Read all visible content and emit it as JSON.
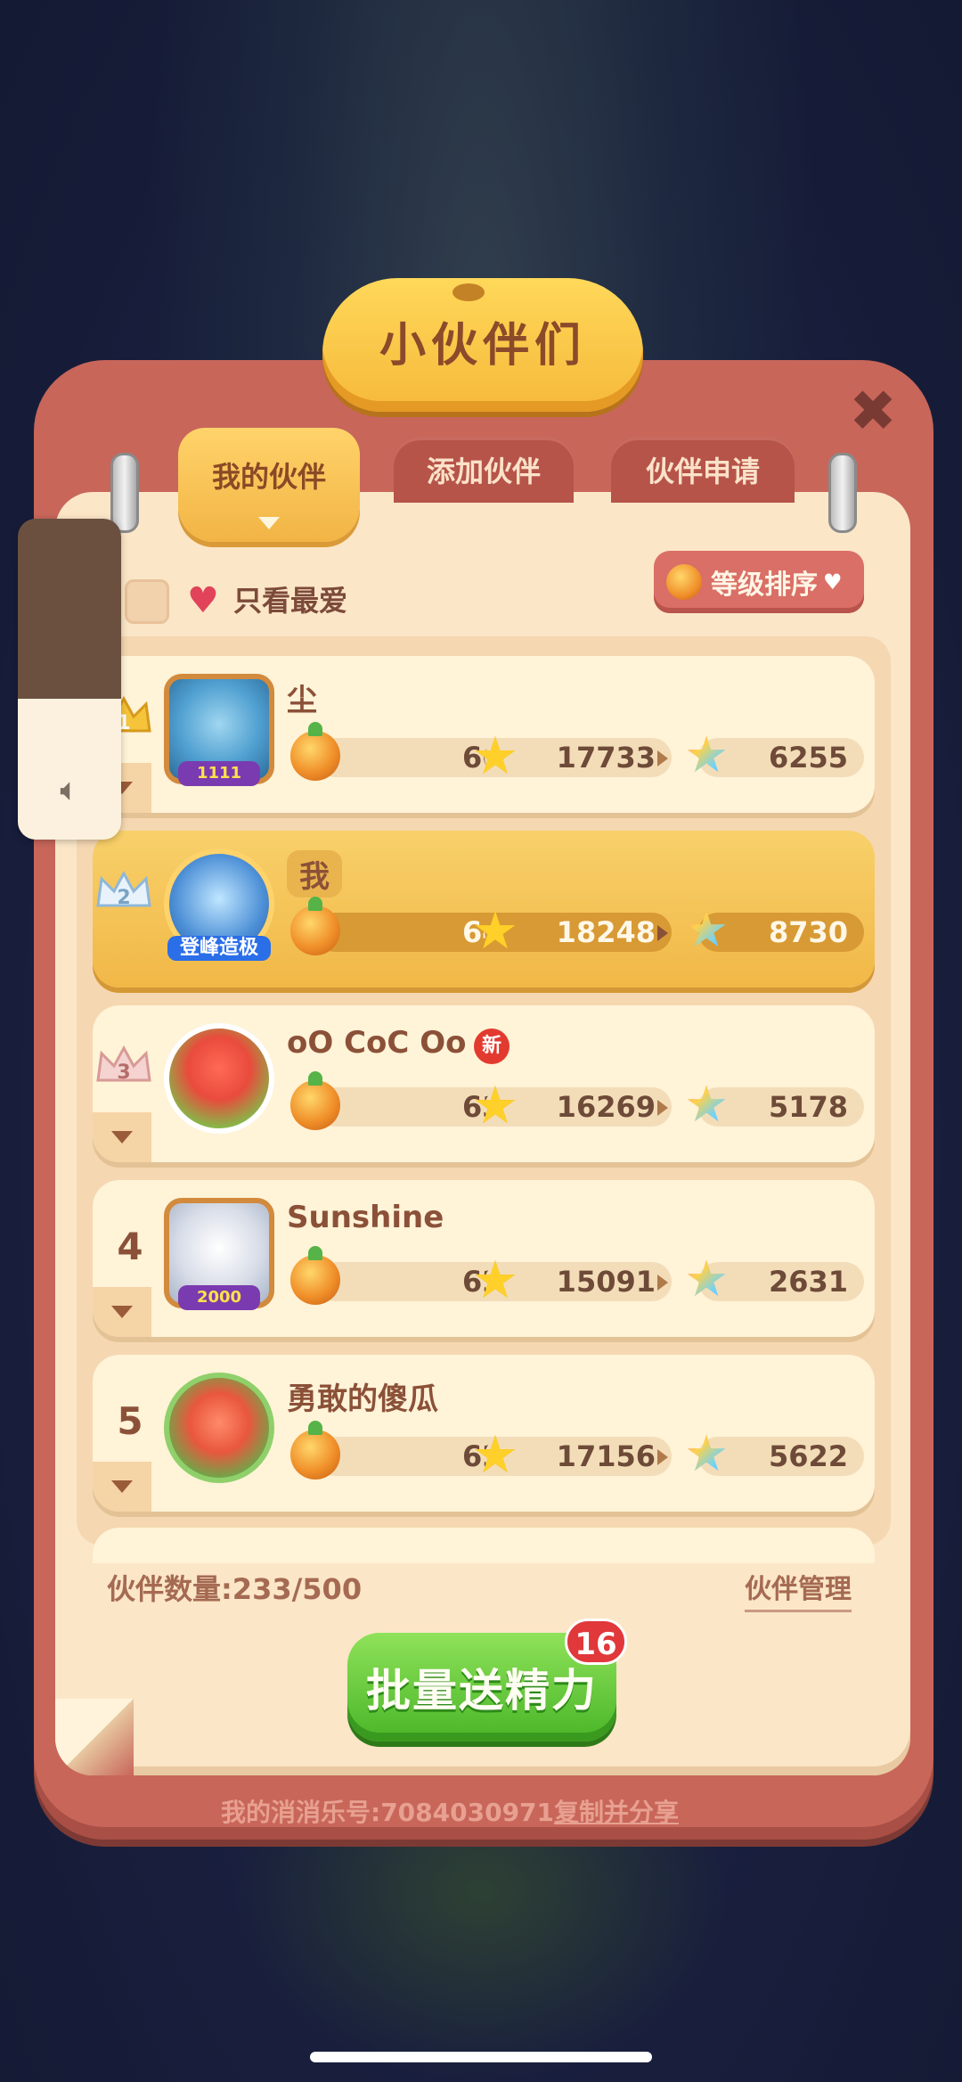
{
  "dialog": {
    "title": "小伙伴们",
    "close_glyph": "✖"
  },
  "tabs": [
    {
      "label": "我的伙伴",
      "active": true
    },
    {
      "label": "添加伙伴",
      "active": false
    },
    {
      "label": "伙伴申请",
      "active": false
    }
  ],
  "filter": {
    "favorite_only_label": "只看最爱",
    "sort_label": "等级排序"
  },
  "partners": [
    {
      "rank": "1",
      "name": "尘",
      "level": "6616",
      "stars": "17733",
      "rainbow": "6255",
      "badge": "1111",
      "is_me": false,
      "is_new": false
    },
    {
      "rank": "2",
      "name": "我",
      "level": "6435",
      "stars": "18248",
      "rainbow": "8730",
      "badge": "登峰造极",
      "is_me": true,
      "is_new": false
    },
    {
      "rank": "3",
      "name": "oO CoC Oo",
      "level": "6375",
      "stars": "16269",
      "rainbow": "5178",
      "badge": "",
      "is_me": false,
      "is_new": true,
      "new_label": "新"
    },
    {
      "rank": "4",
      "name": "Sunshine",
      "level": "6227",
      "stars": "15091",
      "rainbow": "2631",
      "badge": "2000",
      "is_me": false,
      "is_new": false
    },
    {
      "rank": "5",
      "name": "勇敢的傻瓜",
      "level": "6225",
      "stars": "17156",
      "rainbow": "5622",
      "badge": "",
      "is_me": false,
      "is_new": false
    }
  ],
  "footer": {
    "count_label": "伙伴数量:233/500",
    "manage_label": "伙伴管理",
    "send_button_label": "批量送精力",
    "send_badge_count": "16",
    "id_label": "我的消消乐号:7084030971",
    "share_label": "复制并分享"
  },
  "icons": {
    "volume": "speaker-icon",
    "heart": "heart-icon",
    "level": "orb-icon",
    "star": "star-icon",
    "rainbow_star": "rainbow-star-icon"
  },
  "colors": {
    "frame": "#c8665a",
    "panel": "#fbe6c7",
    "accent_yellow": "#f6b93a",
    "button_green": "#49b527",
    "badge_red": "#e0383b"
  }
}
